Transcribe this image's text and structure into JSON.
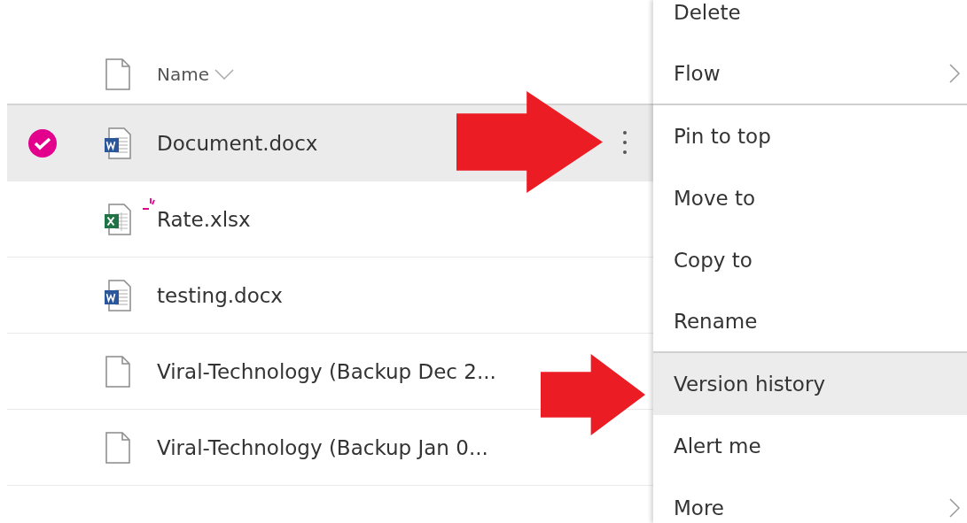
{
  "file_list": {
    "header": {
      "label": "Name"
    },
    "rows": [
      {
        "name": "Document.docx",
        "kind": "word",
        "selected": true,
        "is_new": false
      },
      {
        "name": "Rate.xlsx",
        "kind": "excel",
        "selected": false,
        "is_new": true
      },
      {
        "name": "testing.docx",
        "kind": "word",
        "selected": false,
        "is_new": false
      },
      {
        "name": "Viral-Technology (Backup Dec 2...",
        "kind": "file",
        "selected": false,
        "is_new": false
      },
      {
        "name": "Viral-Technology (Backup Jan 0...",
        "kind": "file",
        "selected": false,
        "is_new": false
      }
    ]
  },
  "context_menu": {
    "items": [
      {
        "label": "Delete",
        "submenu": false,
        "selected": false,
        "divider_after": false
      },
      {
        "label": "Flow",
        "submenu": true,
        "selected": false,
        "divider_after": true
      },
      {
        "label": "Pin to top",
        "submenu": false,
        "selected": false,
        "divider_after": false
      },
      {
        "label": "Move to",
        "submenu": false,
        "selected": false,
        "divider_after": false
      },
      {
        "label": "Copy to",
        "submenu": false,
        "selected": false,
        "divider_after": false
      },
      {
        "label": "Rename",
        "submenu": false,
        "selected": false,
        "divider_after": true
      },
      {
        "label": "Version history",
        "submenu": false,
        "selected": true,
        "divider_after": false
      },
      {
        "label": "Alert me",
        "submenu": false,
        "selected": false,
        "divider_after": false
      },
      {
        "label": "More",
        "submenu": true,
        "selected": false,
        "divider_after": false
      }
    ]
  },
  "callouts": [
    {
      "kind": "arrow"
    },
    {
      "kind": "arrow"
    }
  ]
}
